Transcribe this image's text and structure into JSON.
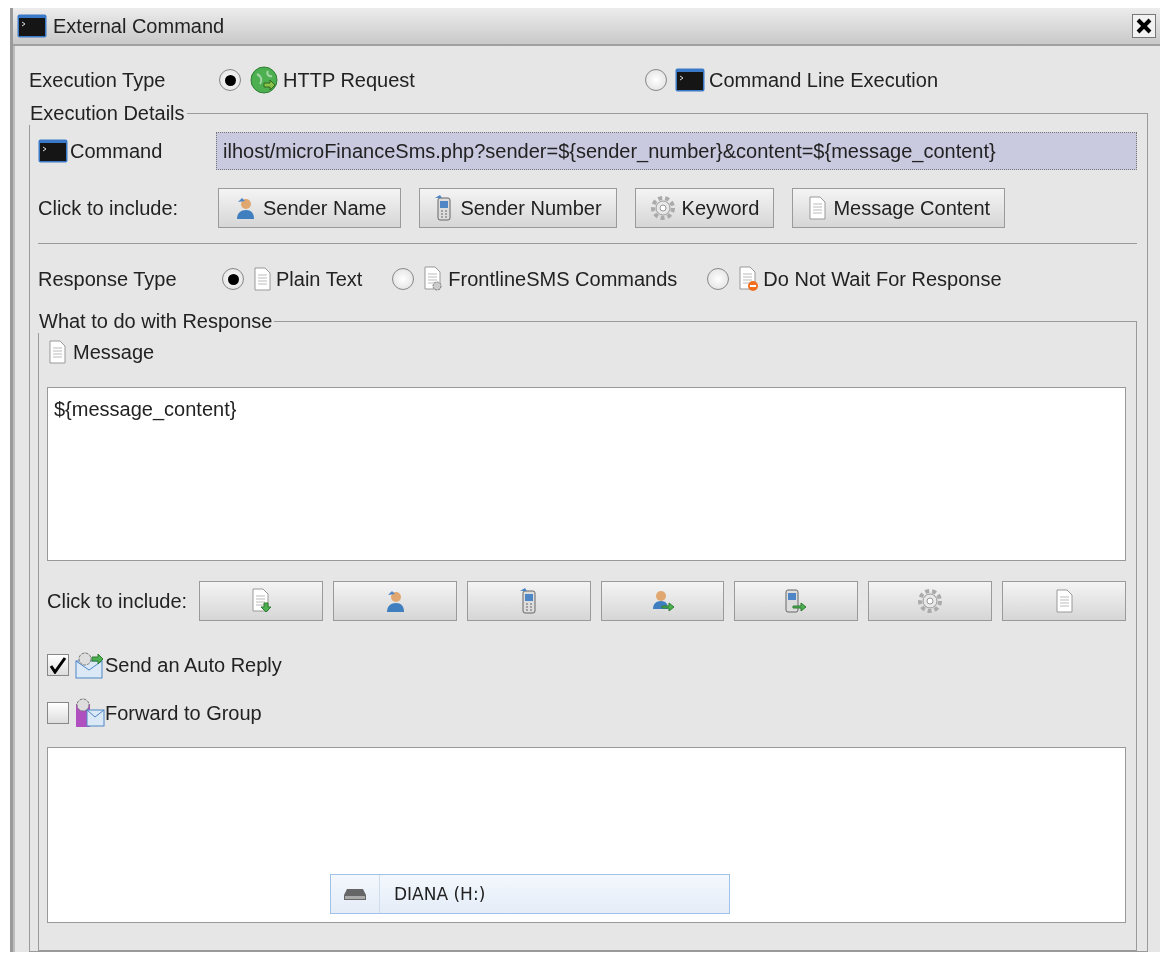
{
  "window": {
    "title": "External Command"
  },
  "execution_type": {
    "label": "Execution Type",
    "options": [
      {
        "label": "HTTP Request",
        "kind": "globe",
        "selected": true
      },
      {
        "label": "Command Line Execution",
        "kind": "terminal",
        "selected": false
      }
    ]
  },
  "execution_details": {
    "legend": "Execution Details",
    "command": {
      "label": "Command",
      "value": "ilhost/microFinanceSms.php?sender=${sender_number}&content=${message_content}"
    },
    "include": {
      "label": "Click to include:",
      "buttons": [
        {
          "label": "Sender Name",
          "kind": "person"
        },
        {
          "label": "Sender Number",
          "kind": "phone"
        },
        {
          "label": "Keyword",
          "kind": "gear"
        },
        {
          "label": "Message Content",
          "kind": "document"
        }
      ]
    }
  },
  "response_type": {
    "label": "Response Type",
    "options": [
      {
        "label": "Plain Text",
        "kind": "document",
        "selected": true
      },
      {
        "label": "FrontlineSMS Commands",
        "kind": "document-gear",
        "selected": false
      },
      {
        "label": "Do Not Wait For Response",
        "kind": "document-stop",
        "selected": false
      }
    ]
  },
  "response": {
    "legend": "What to do with Response",
    "message_label": "Message",
    "message_value": "${message_content}",
    "include": {
      "label": "Click to include:",
      "buttons": [
        {
          "kind": "document-down"
        },
        {
          "kind": "person"
        },
        {
          "kind": "phone"
        },
        {
          "kind": "person-arrow"
        },
        {
          "kind": "phone-arrow"
        },
        {
          "kind": "gear"
        },
        {
          "kind": "document"
        }
      ]
    },
    "options": [
      {
        "label": "Send an Auto Reply",
        "kind": "mail-gear",
        "checked": true
      },
      {
        "label": "Forward to Group",
        "kind": "mail-group",
        "checked": false
      }
    ]
  },
  "tooltip": {
    "label": "DIANA (H:)"
  }
}
